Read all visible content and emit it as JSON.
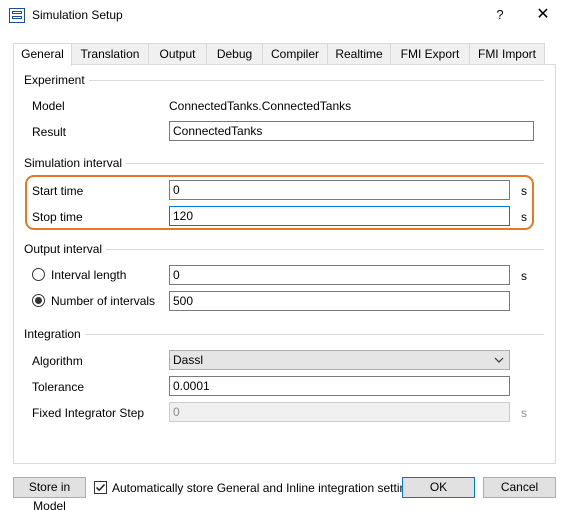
{
  "window": {
    "title": "Simulation Setup",
    "help_label": "?",
    "close_label": "✕"
  },
  "tabs": [
    {
      "label": "General",
      "active": true
    },
    {
      "label": "Translation",
      "active": false
    },
    {
      "label": "Output",
      "active": false
    },
    {
      "label": "Debug",
      "active": false
    },
    {
      "label": "Compiler",
      "active": false
    },
    {
      "label": "Realtime",
      "active": false
    },
    {
      "label": "FMI Export",
      "active": false
    },
    {
      "label": "FMI Import",
      "active": false
    }
  ],
  "experiment": {
    "group_label": "Experiment",
    "model_label": "Model",
    "model_value": "ConnectedTanks.ConnectedTanks",
    "result_label": "Result",
    "result_value": "ConnectedTanks"
  },
  "simulation_interval": {
    "group_label": "Simulation interval",
    "start_label": "Start time",
    "start_value": "0",
    "start_unit": "s",
    "stop_label": "Stop time",
    "stop_value": "120",
    "stop_unit": "s"
  },
  "output_interval": {
    "group_label": "Output interval",
    "interval_length_label": "Interval length",
    "interval_length_value": "0",
    "interval_length_unit": "s",
    "interval_length_selected": false,
    "num_intervals_label": "Number of intervals",
    "num_intervals_value": "500",
    "num_intervals_selected": true
  },
  "integration": {
    "group_label": "Integration",
    "algorithm_label": "Algorithm",
    "algorithm_value": "Dassl",
    "tolerance_label": "Tolerance",
    "tolerance_value": "0.0001",
    "fixed_step_label": "Fixed Integrator Step",
    "fixed_step_value": "0",
    "fixed_step_unit": "s"
  },
  "footer": {
    "store_button_label": "Store in Model",
    "auto_store_label": "Automatically store General and Inline integration settings",
    "auto_store_checked": true,
    "ok_label": "OK",
    "cancel_label": "Cancel"
  },
  "colors": {
    "highlight": "#e87722",
    "focus": "#0078d7"
  }
}
